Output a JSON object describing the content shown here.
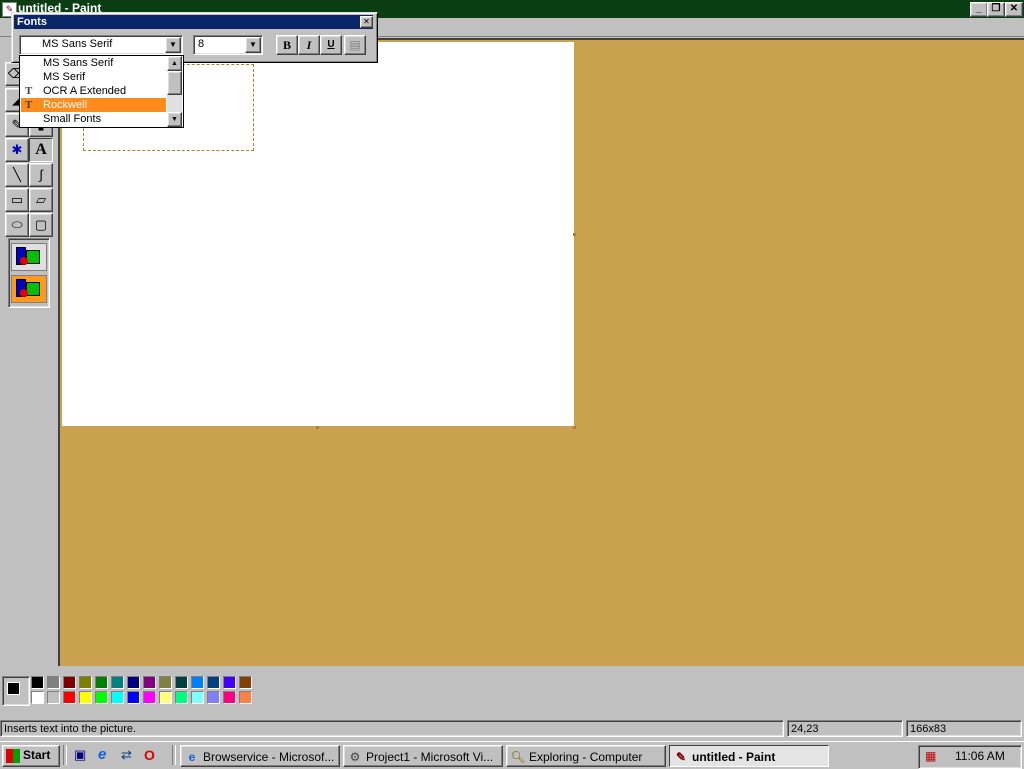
{
  "window": {
    "title": "untitled - Paint",
    "minimize": "_",
    "maximize": "❐",
    "close": "✕"
  },
  "fonts_toolbar": {
    "title": "Fonts",
    "close": "✕",
    "font_value": "MS Sans Serif",
    "size_value": "8",
    "bold": "B",
    "italic": "I",
    "underline": "U",
    "vertical": "▤"
  },
  "font_list": {
    "items": [
      {
        "label": "MS Sans Serif",
        "tt": false,
        "selected": false
      },
      {
        "label": "MS Serif",
        "tt": false,
        "selected": false
      },
      {
        "label": "OCR A Extended",
        "tt": true,
        "selected": false
      },
      {
        "label": "Rockwell",
        "tt": true,
        "selected": true
      },
      {
        "label": "Small Fonts",
        "tt": false,
        "selected": false
      }
    ]
  },
  "palette": {
    "row1": [
      "#000000",
      "#808080",
      "#800000",
      "#808000",
      "#008000",
      "#008080",
      "#000080",
      "#800080",
      "#808040",
      "#004040",
      "#0080ff",
      "#004080",
      "#4000ff",
      "#804000"
    ],
    "row2": [
      "#ffffff",
      "#c0c0c0",
      "#ff0000",
      "#ffff00",
      "#00ff00",
      "#00ffff",
      "#0000ff",
      "#ff00ff",
      "#ffff80",
      "#00ff80",
      "#80ffff",
      "#8080ff",
      "#ff0080",
      "#ff8040"
    ]
  },
  "status": {
    "help": "Inserts text into the picture.",
    "coords": "24,23",
    "size": "166x83"
  },
  "taskbar": {
    "start": "Start",
    "buttons": [
      {
        "label": "Browservice - Microsof...",
        "icon": "browser-icon"
      },
      {
        "label": "Project1 - Microsoft Vi...",
        "icon": "vb-project-icon"
      },
      {
        "label": "Exploring - Computer",
        "icon": "explorer-icon"
      },
      {
        "label": "untitled - Paint",
        "icon": "paint-icon",
        "active": true
      }
    ],
    "clock": "11:06 AM"
  }
}
